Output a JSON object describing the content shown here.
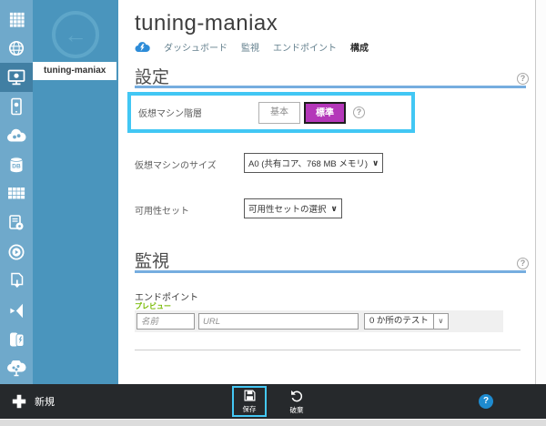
{
  "window": {
    "title": "tuning-maniax"
  },
  "colors": {
    "sidebar_strip": "#6FA9CB",
    "sidebar_panel": "#4A95BD",
    "sidebar_selected_bg": "#417FA3",
    "accent_highlight_cyan": "#42C7F4",
    "tier_selected_magenta": "#B437B9",
    "section_rule_blue": "#76ADDF",
    "preview_green": "#76B900",
    "command_bar_dark": "#26292C",
    "help_circle_blue": "#1E8BD0"
  },
  "icons": {
    "chevron_down": "∨",
    "back_arrow": "←",
    "help": "?",
    "db_label": "DB",
    "sidebar": [
      "all-items-grid-icon",
      "websites-globe-icon",
      "virtual-machines-icon",
      "mobile-services-icon",
      "cloud-services-icon",
      "sql-databases-icon",
      "storage-tables-icon",
      "hdinsight-icon",
      "media-services-icon",
      "import-document-icon",
      "visual-studio-icon",
      "backup-vault-icon",
      "automation-cloud-icon"
    ]
  },
  "sidebar": {
    "selected_item": "tuning-maniax"
  },
  "header": {
    "title": "tuning-maniax",
    "tabs": [
      {
        "label": "ダッシュボード",
        "active": false
      },
      {
        "label": "監視",
        "active": false
      },
      {
        "label": "エンドポイント",
        "active": false
      },
      {
        "label": "構成",
        "active": true
      }
    ]
  },
  "settings": {
    "section_title": "設定",
    "vm_tier": {
      "label": "仮想マシン階層",
      "options": [
        {
          "label": "基本",
          "selected": false
        },
        {
          "label": "標準",
          "selected": true
        }
      ]
    },
    "vm_size": {
      "label": "仮想マシンのサイズ",
      "value": "A0 (共有コア、768 MB メモリ)"
    },
    "availability_set": {
      "label": "可用性セット",
      "value": "可用性セットの選択"
    }
  },
  "monitoring": {
    "section_title": "監視",
    "endpoints": {
      "label": "エンドポイント",
      "badge": "プレビュー",
      "name_placeholder": "名前",
      "url_placeholder": "URL",
      "test_locations": "0 か所のテスト"
    }
  },
  "command_bar": {
    "new_label": "新規",
    "save_label": "保存",
    "discard_label": "破棄"
  }
}
